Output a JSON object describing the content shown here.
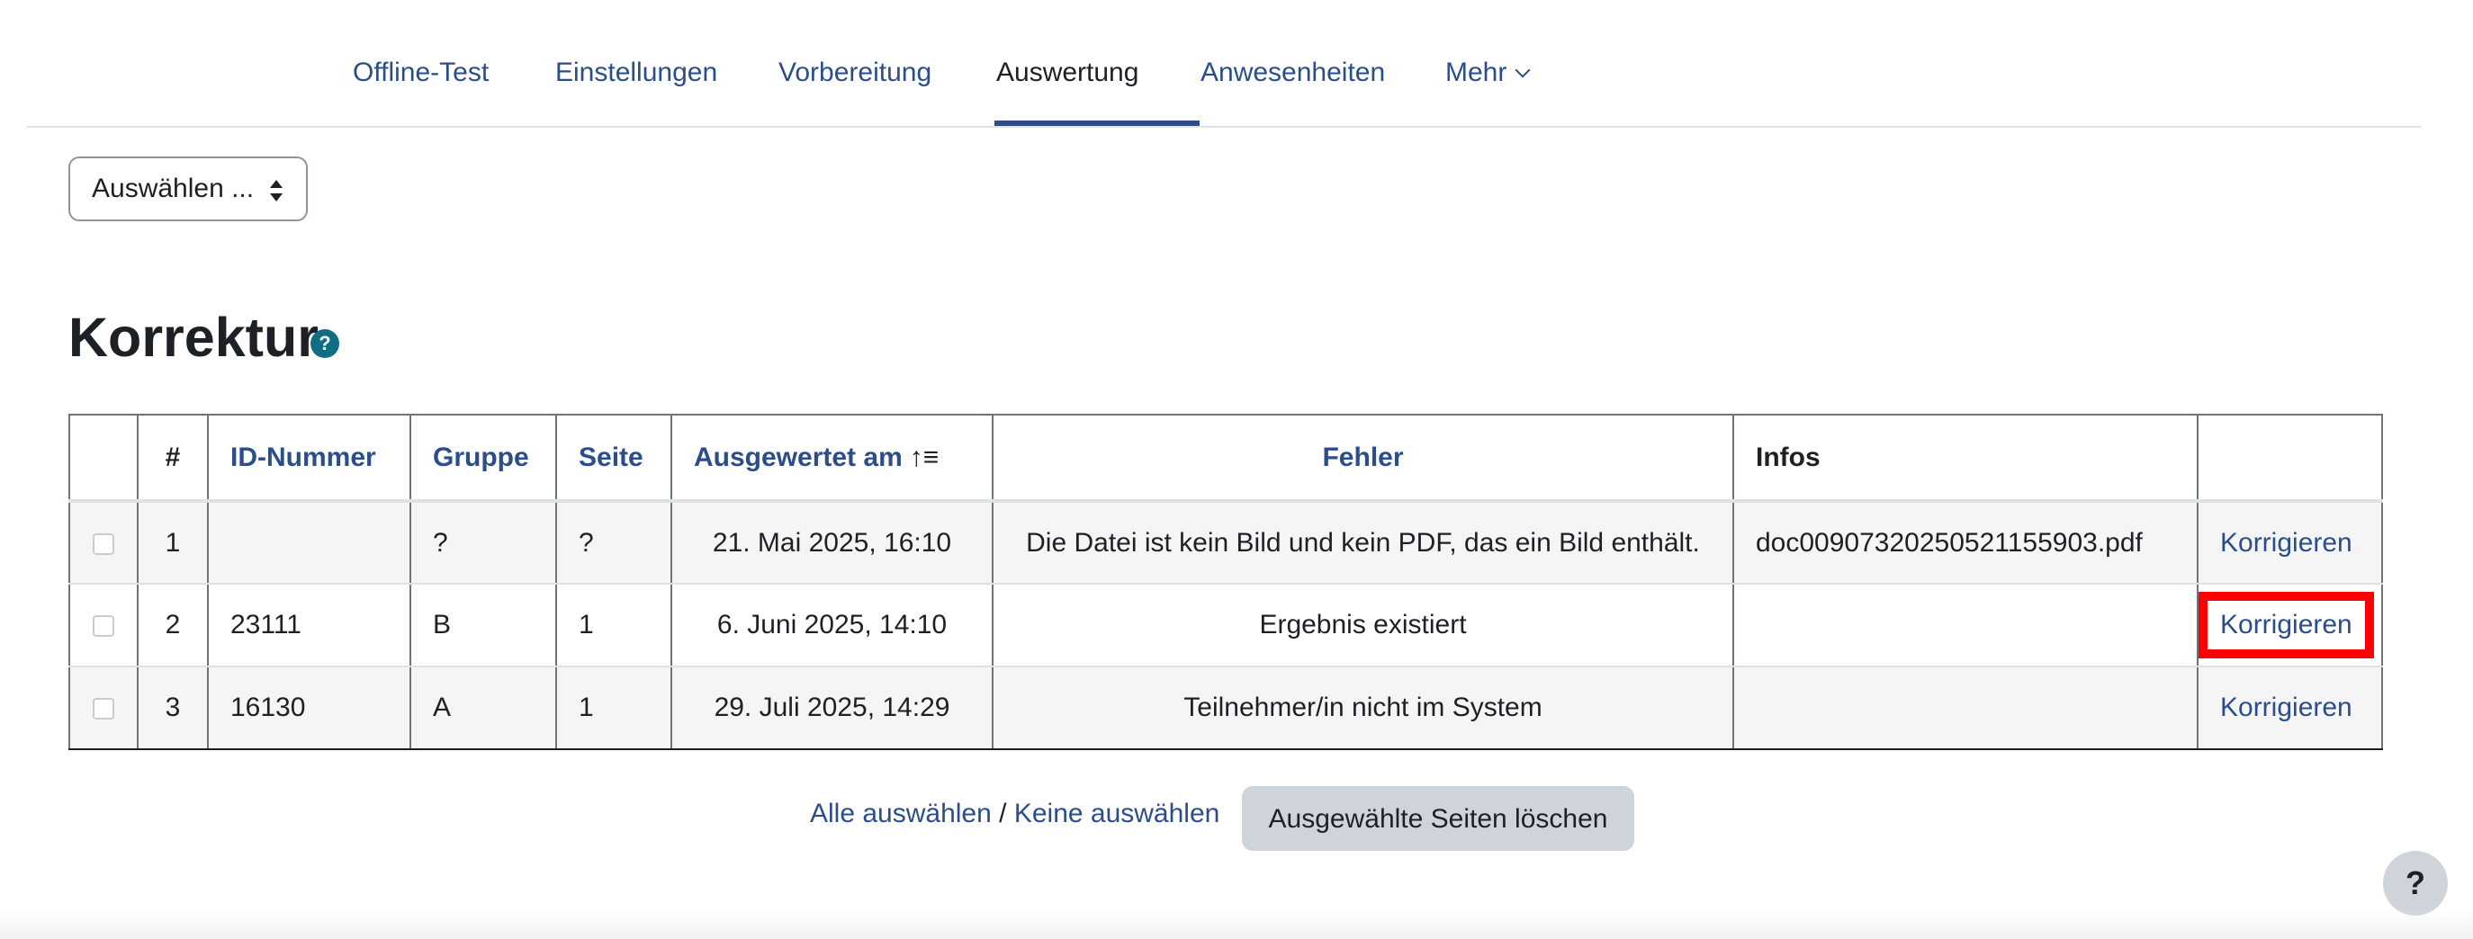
{
  "nav": {
    "tabs": [
      {
        "label": "Offline-Test"
      },
      {
        "label": "Einstellungen"
      },
      {
        "label": "Vorbereitung"
      },
      {
        "label": "Auswertung"
      },
      {
        "label": "Anwesenheiten"
      },
      {
        "label": "Mehr"
      }
    ],
    "active_tab": "Auswertung"
  },
  "select": {
    "value": "Auswählen ..."
  },
  "heading": {
    "title": "Korrektur",
    "help_icon": "?"
  },
  "table": {
    "headers": [
      "",
      "#",
      "ID-Nummer",
      "Gruppe",
      "Seite",
      "Ausgewertet am",
      "Fehler",
      "Infos",
      ""
    ],
    "sort_icon": "↑≡",
    "rows": [
      {
        "num": "1",
        "id": "",
        "group": "?",
        "page": "?",
        "date": "21. Mai 2025, 16:10",
        "error": "Die Datei ist kein Bild und kein PDF, das ein Bild enthält.",
        "info": "doc00907320250521155903.pdf",
        "action": "Korrigieren"
      },
      {
        "num": "2",
        "id": "23111",
        "group": "B",
        "page": "1",
        "date": "6. Juni 2025, 14:10",
        "error": "Ergebnis existiert",
        "info": "",
        "action": "Korrigieren"
      },
      {
        "num": "3",
        "id": "16130",
        "group": "A",
        "page": "1",
        "date": "29. Juli 2025, 14:29",
        "error": "Teilnehmer/in nicht im System",
        "info": "",
        "action": "Korrigieren"
      }
    ]
  },
  "footer": {
    "select_all": "Alle auswählen",
    "separator": "/",
    "select_none": "Keine auswählen",
    "delete_button": "Ausgewählte Seiten löschen"
  },
  "help_button": "?",
  "colors": {
    "link": "#2b4e8a",
    "highlight": "#ff0000",
    "help_dot": "#0f6e84",
    "button_bg": "#ced4da"
  }
}
